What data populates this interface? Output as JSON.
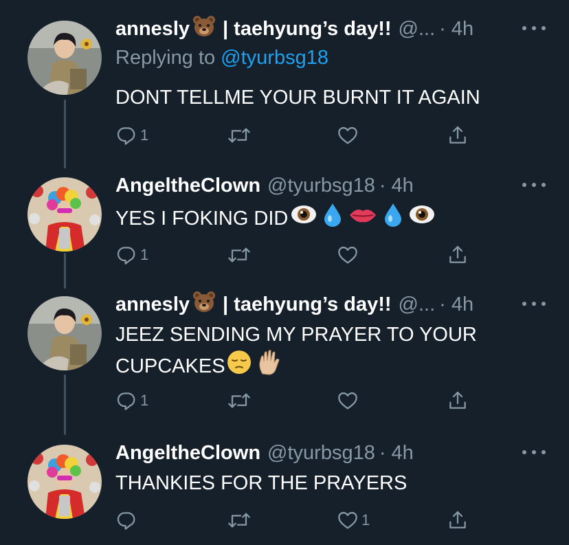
{
  "colors": {
    "background": "#15202b",
    "text": "#ffffff",
    "muted": "#8899a6",
    "link": "#1da1f2",
    "thread_line": "#3d5466"
  },
  "tweets": [
    {
      "author": "annesly",
      "author_suffix": "| taehyung’s day!!",
      "handle": "@...",
      "time": "· 4h",
      "reply_prefix": "Replying to ",
      "reply_handle": "@tyurbsg18",
      "text_lines": [
        "DONT TELLME YOUR BURNT IT AGAIN"
      ],
      "reply_count": "1",
      "retweet_count": "",
      "like_count": ""
    },
    {
      "author": "AngeltheClown",
      "handle": "@tyurbsg18",
      "time": "· 4h",
      "text_lines": [
        "YES I FOKING DID"
      ],
      "reply_count": "1",
      "retweet_count": "",
      "like_count": ""
    },
    {
      "author": "annesly",
      "author_suffix": "| taehyung’s day!!",
      "handle": "@...",
      "time": "· 4h",
      "text_lines": [
        "JEEZ SENDING MY PRAYER TO YOUR",
        "CUPCAKES"
      ],
      "reply_count": "1",
      "retweet_count": "",
      "like_count": ""
    },
    {
      "author": "AngeltheClown",
      "handle": "@tyurbsg18",
      "time": "· 4h",
      "text_lines": [
        "THANKIES FOR THE PRAYERS"
      ],
      "reply_count": "",
      "retweet_count": "",
      "like_count": "1"
    }
  ]
}
